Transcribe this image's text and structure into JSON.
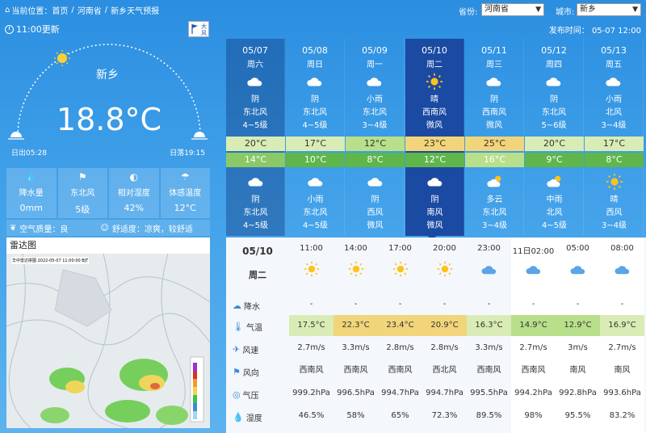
{
  "breadcrumb": {
    "prefix": "当前位置：",
    "items": [
      "首页",
      "河南省",
      "新乡天气预报"
    ]
  },
  "selectors": {
    "province_label": "省份:",
    "province_value": "河南省",
    "city_label": "城市:",
    "city_value": "新乡"
  },
  "update_time": "11:00更新",
  "alert_badge": [
    "大",
    "风"
  ],
  "publish_time": "发布时间： 05-07 12:00",
  "current": {
    "city": "新乡",
    "temperature": "18.8°C",
    "sunrise": "日出05:28",
    "sunset": "日落19:15",
    "stats": [
      {
        "label": "降水量",
        "value": "0mm",
        "icon": "drop-icon"
      },
      {
        "label": "东北风",
        "value": "5级",
        "icon": "wind-icon"
      },
      {
        "label": "相对湿度",
        "value": "42%",
        "icon": "humidity-icon"
      },
      {
        "label": "体感温度",
        "value": "12°C",
        "icon": "feel-temp-icon"
      }
    ],
    "air_quality": "空气质量：良",
    "comfort": "舒适度：凉爽，较舒适"
  },
  "radar": {
    "title": "雷达图",
    "caption": "华中雷达拼图 2022-05-07 11:00:00 BJT"
  },
  "days": [
    {
      "date": "05/07",
      "week": "周六",
      "day_icon": "cloud",
      "day_weather": "阴",
      "day_wind": "东北风",
      "day_level": "4~5级",
      "high": "20°C",
      "low": "14°C",
      "night_icon": "cloud",
      "night_weather": "阴",
      "night_wind": "东北风",
      "night_level": "4~5级"
    },
    {
      "date": "05/08",
      "week": "周日",
      "day_icon": "cloud",
      "day_weather": "阴",
      "day_wind": "东北风",
      "day_level": "4~5级",
      "high": "17°C",
      "low": "10°C",
      "night_icon": "cloud",
      "night_weather": "小雨",
      "night_wind": "东北风",
      "night_level": "4~5级"
    },
    {
      "date": "05/09",
      "week": "周一",
      "day_icon": "cloud",
      "day_weather": "小雨",
      "day_wind": "东北风",
      "day_level": "3~4级",
      "high": "12°C",
      "low": "8°C",
      "night_icon": "cloud",
      "night_weather": "阴",
      "night_wind": "西风",
      "night_level": "微风"
    },
    {
      "date": "05/10",
      "week": "周二",
      "day_icon": "sun",
      "day_weather": "晴",
      "day_wind": "西南风",
      "day_level": "微风",
      "high": "23°C",
      "low": "12°C",
      "night_icon": "cloud",
      "night_weather": "阴",
      "night_wind": "南风",
      "night_level": "微风"
    },
    {
      "date": "05/11",
      "week": "周三",
      "day_icon": "cloud",
      "day_weather": "阴",
      "day_wind": "西南风",
      "day_level": "微风",
      "high": "25°C",
      "low": "16°C",
      "night_icon": "partly",
      "night_weather": "多云",
      "night_wind": "东北风",
      "night_level": "3~4级"
    },
    {
      "date": "05/12",
      "week": "周四",
      "day_icon": "cloud",
      "day_weather": "阴",
      "day_wind": "东北风",
      "day_level": "5~6级",
      "high": "20°C",
      "low": "9°C",
      "night_icon": "partly",
      "night_weather": "中雨",
      "night_wind": "北风",
      "night_level": "4~5级"
    },
    {
      "date": "05/13",
      "week": "周五",
      "day_icon": "cloud",
      "day_weather": "小雨",
      "day_wind": "北风",
      "day_level": "3~4级",
      "high": "17°C",
      "low": "8°C",
      "night_icon": "sun",
      "night_weather": "晴",
      "night_wind": "西风",
      "night_level": "3~4级"
    }
  ],
  "hourly": {
    "date": "05/10",
    "week": "周二",
    "row_labels": [
      "降水",
      "气温",
      "风速",
      "风向",
      "气压",
      "湿度"
    ],
    "columns": [
      {
        "time": "11:00",
        "icon": "sun",
        "rain": "-",
        "temp": "17.5°C",
        "speed": "2.7m/s",
        "dir": "西南风",
        "pressure": "999.2hPa",
        "humidity": "46.5%"
      },
      {
        "time": "14:00",
        "icon": "sun",
        "rain": "-",
        "temp": "22.3°C",
        "speed": "3.3m/s",
        "dir": "西南风",
        "pressure": "996.5hPa",
        "humidity": "58%"
      },
      {
        "time": "17:00",
        "icon": "sun",
        "rain": "-",
        "temp": "23.4°C",
        "speed": "2.8m/s",
        "dir": "西南风",
        "pressure": "994.7hPa",
        "humidity": "65%"
      },
      {
        "time": "20:00",
        "icon": "sun",
        "rain": "-",
        "temp": "20.9°C",
        "speed": "2.8m/s",
        "dir": "西北风",
        "pressure": "994.7hPa",
        "humidity": "72.3%"
      },
      {
        "time": "23:00",
        "icon": "cloud",
        "rain": "-",
        "temp": "16.3°C",
        "speed": "3.3m/s",
        "dir": "西南风",
        "pressure": "995.5hPa",
        "humidity": "89.5%"
      },
      {
        "time": "11日02:00",
        "icon": "cloud",
        "rain": "-",
        "temp": "14.9°C",
        "speed": "2.7m/s",
        "dir": "西南风",
        "pressure": "994.2hPa",
        "humidity": "98%"
      },
      {
        "time": "05:00",
        "icon": "cloud",
        "rain": "-",
        "temp": "12.9°C",
        "speed": "3m/s",
        "dir": "南风",
        "pressure": "992.8hPa",
        "humidity": "95.5%"
      },
      {
        "time": "08:00",
        "icon": "cloud",
        "rain": "-",
        "temp": "16.9°C",
        "speed": "2.7m/s",
        "dir": "南风",
        "pressure": "993.6hPa",
        "humidity": "83.2%"
      }
    ]
  },
  "colors": {
    "high_bands": [
      "#d9ecb5",
      "#d9ecb5",
      "#b8df8a",
      "#f2d57a",
      "#f2d57a",
      "#d9ecb5",
      "#d9ecb5"
    ],
    "low_bands": [
      "#8bc866",
      "#5fb64b",
      "#5fb64b",
      "#5fb64b",
      "#b8df8a",
      "#5fb64b",
      "#5fb64b"
    ],
    "temp_cells": [
      "#d9ecb5",
      "#f2d57a",
      "#f2d57a",
      "#f2d57a",
      "#d9ecb5",
      "#b8df8a",
      "#b8df8a",
      "#d9ecb5"
    ]
  }
}
